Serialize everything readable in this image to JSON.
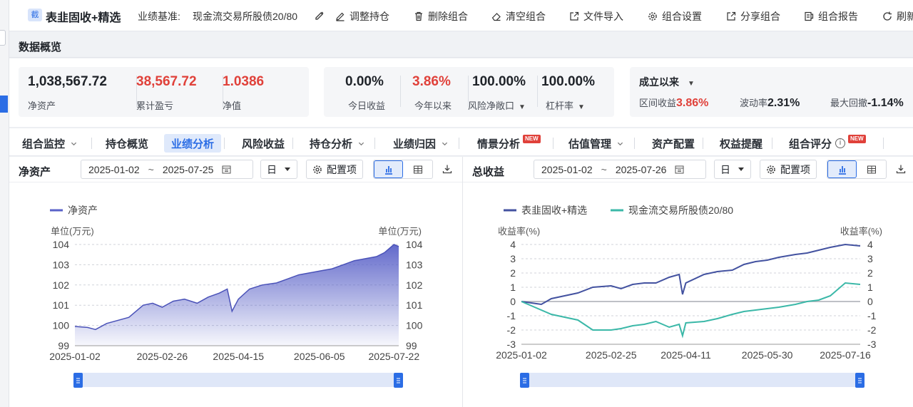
{
  "header": {
    "tag": "截",
    "portfolio_name": "表韭固收+精选",
    "benchmark_label": "业绩基准:",
    "benchmark_value": "现金流交易所股债20/80",
    "actions": [
      "调整持仓",
      "删除组合",
      "清空组合",
      "文件导入",
      "组合设置",
      "分享组合",
      "组合报告",
      "刷新"
    ]
  },
  "overview": {
    "section_title": "数据概览",
    "card1": [
      {
        "value": "1,038,567.72",
        "label": "净资产"
      },
      {
        "value": "38,567.72",
        "label": "累计盈亏"
      },
      {
        "value": "1.0386",
        "label": "净值"
      }
    ],
    "card2": [
      {
        "value": "0.00%",
        "label": "今日收益"
      },
      {
        "value": "3.86%",
        "label": "今年以来"
      },
      {
        "value": "100.00%",
        "label": "风险净敞口"
      },
      {
        "value": "100.00%",
        "label": "杠杆率"
      }
    ],
    "card3": {
      "period": "成立以来",
      "range_label": "区间收益",
      "range_value": "3.86%",
      "vol_label": "波动率",
      "vol_value": "2.31%",
      "dd_label": "最大回撤",
      "dd_value": "-1.14%"
    }
  },
  "tabs": [
    {
      "label": "组合监控",
      "dropdown": true
    },
    {
      "label": "持仓概览"
    },
    {
      "label": "业绩分析",
      "active": true
    },
    {
      "label": "风险收益"
    },
    {
      "label": "持仓分析",
      "dropdown": true
    },
    {
      "label": "业绩归因",
      "dropdown": true
    },
    {
      "label": "情景分析",
      "badge": "NEW"
    },
    {
      "label": "估值管理",
      "dropdown": true
    },
    {
      "label": "资产配置"
    },
    {
      "label": "权益提醒"
    },
    {
      "label": "组合评分",
      "info": true,
      "badge": "NEW"
    }
  ],
  "left_panel": {
    "title": "净资产",
    "date_from": "2025-01-02",
    "date_tilde": "~",
    "date_to": "2025-07-25",
    "freq": "日",
    "config": "配置项"
  },
  "right_panel": {
    "title": "总收益",
    "date_from": "2025-01-02",
    "date_tilde": "~",
    "date_to": "2025-07-26",
    "freq": "日",
    "config": "配置项"
  },
  "chart_data": [
    {
      "type": "area",
      "series": [
        {
          "name": "净资产",
          "color": "#5a62c8"
        }
      ],
      "ylabel_left": "单位(万元)",
      "ylabel_right": "单位(万元)",
      "ylim": [
        99,
        104
      ],
      "yticks": [
        99,
        100,
        101,
        102,
        103,
        104
      ],
      "xticks": [
        "2025-01-02",
        "2025-02-26",
        "2025-04-15",
        "2025-06-05",
        "2025-07-22"
      ],
      "x": [
        "2025-01-02",
        "2025-01-10",
        "2025-01-15",
        "2025-01-22",
        "2025-02-05",
        "2025-02-14",
        "2025-02-20",
        "2025-02-26",
        "2025-03-05",
        "2025-03-12",
        "2025-03-20",
        "2025-03-27",
        "2025-04-03",
        "2025-04-08",
        "2025-04-11",
        "2025-04-15",
        "2025-04-22",
        "2025-04-30",
        "2025-05-09",
        "2025-05-16",
        "2025-05-23",
        "2025-05-30",
        "2025-06-06",
        "2025-06-13",
        "2025-06-20",
        "2025-06-27",
        "2025-07-04",
        "2025-07-11",
        "2025-07-16",
        "2025-07-22",
        "2025-07-25"
      ],
      "values": [
        99.95,
        99.9,
        99.8,
        100.1,
        100.4,
        101.0,
        101.1,
        100.9,
        101.2,
        101.3,
        101.1,
        101.4,
        101.6,
        101.8,
        100.7,
        101.3,
        101.8,
        102.0,
        102.1,
        102.3,
        102.5,
        102.6,
        102.7,
        102.8,
        103.0,
        103.2,
        103.3,
        103.4,
        103.6,
        104.0,
        103.9
      ]
    },
    {
      "type": "line",
      "series": [
        {
          "name": "表韭固收+精选",
          "color": "#4352a0",
          "values": [
            0.0,
            -0.1,
            -0.2,
            0.2,
            0.6,
            1.0,
            1.1,
            0.9,
            1.2,
            1.3,
            1.3,
            1.7,
            1.9,
            0.5,
            1.3,
            1.9,
            2.1,
            2.2,
            2.6,
            2.8,
            2.9,
            3.1,
            3.3,
            3.4,
            3.6,
            3.8,
            4.0,
            3.9
          ]
        },
        {
          "name": "现金流交易所股债20/80",
          "color": "#3bb8a8",
          "values": [
            0.0,
            -0.3,
            -0.6,
            -0.9,
            -1.3,
            -2.0,
            -2.0,
            -1.9,
            -1.7,
            -1.6,
            -1.4,
            -1.8,
            -1.6,
            -2.4,
            -1.5,
            -1.4,
            -1.2,
            -0.9,
            -0.7,
            -0.6,
            -0.5,
            -0.4,
            -0.2,
            0.0,
            0.1,
            0.4,
            1.3,
            1.2
          ]
        }
      ],
      "x": [
        "2025-01-02",
        "2025-01-08",
        "2025-01-14",
        "2025-01-20",
        "2025-02-05",
        "2025-02-14",
        "2025-02-25",
        "2025-03-03",
        "2025-03-10",
        "2025-03-17",
        "2025-03-24",
        "2025-04-01",
        "2025-04-07",
        "2025-04-09",
        "2025-04-11",
        "2025-04-22",
        "2025-04-30",
        "2025-05-09",
        "2025-05-16",
        "2025-05-23",
        "2025-05-30",
        "2025-06-06",
        "2025-06-16",
        "2025-06-23",
        "2025-06-30",
        "2025-07-07",
        "2025-07-16",
        "2025-07-25"
      ],
      "ylabel_left": "收益率(%)",
      "ylabel_right": "收益率(%)",
      "ylim": [
        -3,
        4
      ],
      "yticks": [
        -3,
        -2,
        -1,
        0,
        1,
        2,
        3,
        4
      ],
      "xticks": [
        "2025-01-02",
        "2025-02-25",
        "2025-04-11",
        "2025-05-30",
        "2025-07-16"
      ]
    }
  ]
}
